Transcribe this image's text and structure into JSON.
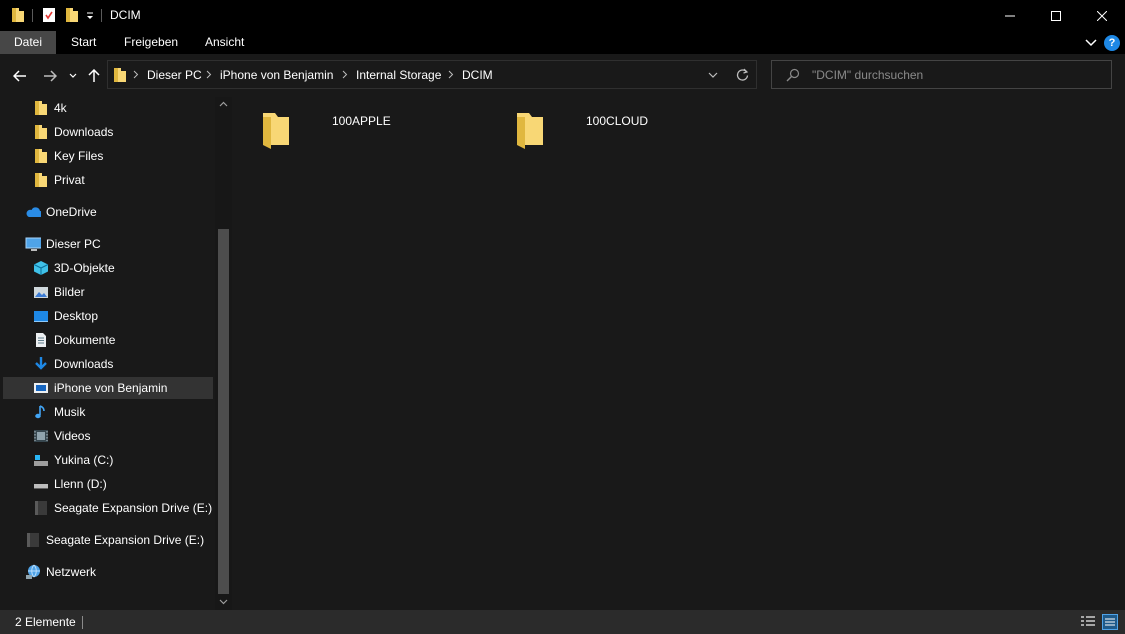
{
  "window": {
    "title": "DCIM"
  },
  "ribbon": {
    "tabs": [
      "Datei",
      "Start",
      "Freigeben",
      "Ansicht"
    ],
    "help_label": "?"
  },
  "address": {
    "crumbs": [
      "Dieser PC",
      "iPhone von Benjamin",
      "Internal Storage",
      "DCIM"
    ]
  },
  "search": {
    "placeholder": "\"DCIM\" durchsuchen"
  },
  "sidebar": {
    "items": [
      {
        "label": "4k",
        "icon": "folder-icon"
      },
      {
        "label": "Downloads",
        "icon": "folder-icon"
      },
      {
        "label": "Key Files",
        "icon": "folder-icon"
      },
      {
        "label": "Privat",
        "icon": "folder-icon"
      },
      {
        "label": "OneDrive",
        "icon": "onedrive-icon"
      },
      {
        "label": "Dieser PC",
        "icon": "computer-icon"
      },
      {
        "label": "3D-Objekte",
        "icon": "3d-objects-icon"
      },
      {
        "label": "Bilder",
        "icon": "pictures-icon"
      },
      {
        "label": "Desktop",
        "icon": "desktop-icon"
      },
      {
        "label": "Dokumente",
        "icon": "documents-icon"
      },
      {
        "label": "Downloads",
        "icon": "download-icon"
      },
      {
        "label": "iPhone von Benjamin",
        "icon": "phone-device-icon"
      },
      {
        "label": "Musik",
        "icon": "music-icon"
      },
      {
        "label": "Videos",
        "icon": "videos-icon"
      },
      {
        "label": "Yukina (C:)",
        "icon": "system-drive-icon"
      },
      {
        "label": "Llenn (D:)",
        "icon": "drive-icon"
      },
      {
        "label": "Seagate Expansion Drive (E:)",
        "icon": "external-drive-icon"
      },
      {
        "label": "Seagate Expansion Drive (E:)",
        "icon": "external-drive-icon"
      },
      {
        "label": "Netzwerk",
        "icon": "network-icon"
      }
    ]
  },
  "content": {
    "folders": [
      "100APPLE",
      "100CLOUD"
    ]
  },
  "status": {
    "count": "2 Elemente"
  },
  "colors": {
    "folder": "#f8d775",
    "folder_dark": "#e0b73f",
    "accent": "#1e88e5",
    "selected": "#333333"
  }
}
